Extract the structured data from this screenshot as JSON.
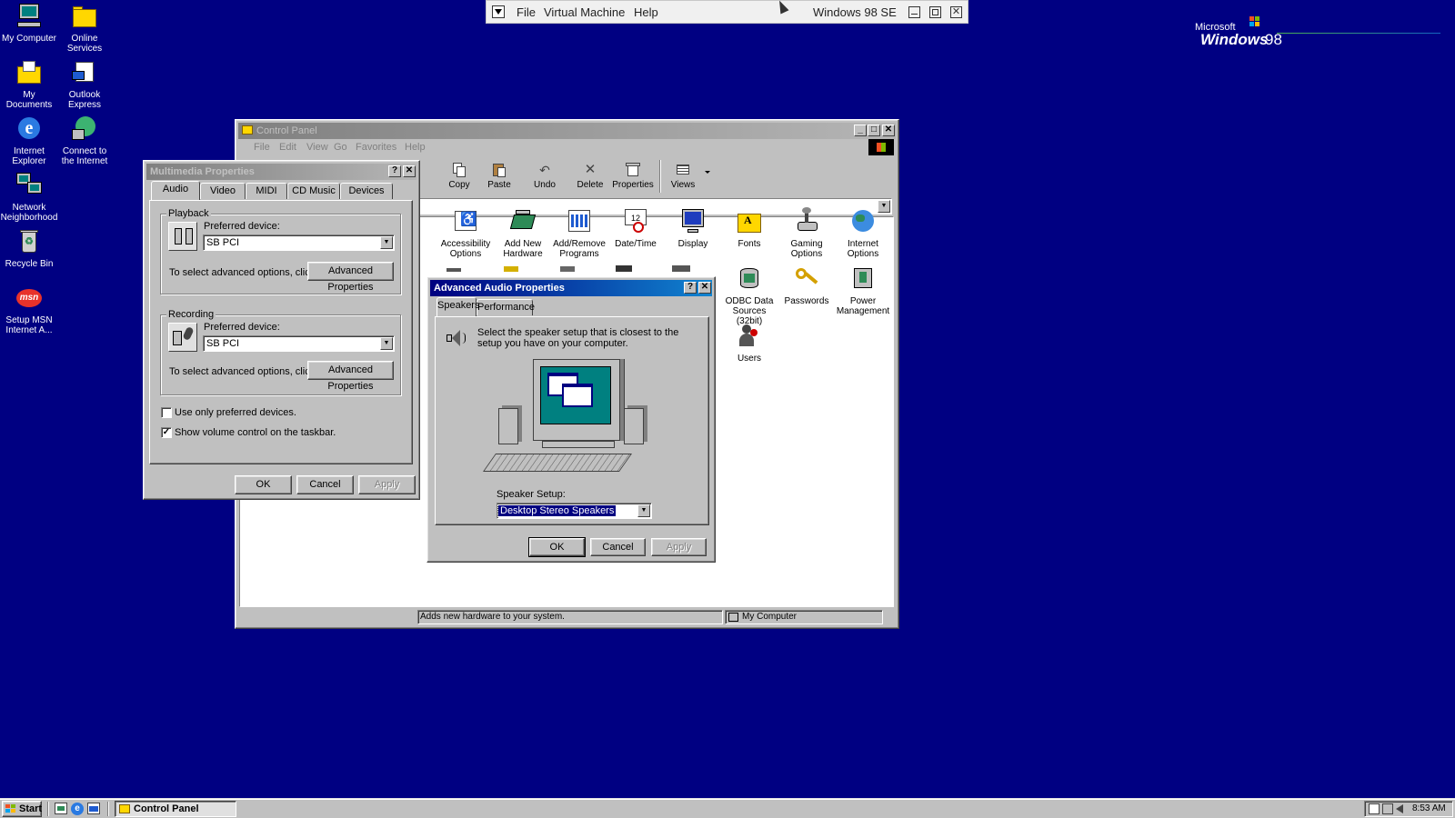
{
  "vm_bar": {
    "menu": [
      "File",
      "Virtual Machine",
      "Help"
    ],
    "os_title": "Windows 98 SE"
  },
  "logo": {
    "line1": "Microsoft",
    "line2": "Windows",
    "version": "98"
  },
  "desktop_icons": [
    {
      "label": "My Computer",
      "icon": "my-computer-icon"
    },
    {
      "label": "Online Services",
      "icon": "folder-icon"
    },
    {
      "label": "My Documents",
      "icon": "my-documents-icon"
    },
    {
      "label": "Outlook Express",
      "icon": "outlook-express-icon"
    },
    {
      "label": "Internet Explorer",
      "icon": "internet-explorer-icon"
    },
    {
      "label": "Connect to the Internet",
      "icon": "connect-internet-icon"
    },
    {
      "label": "Network Neighborhood",
      "icon": "network-icon"
    },
    {
      "label": "Recycle Bin",
      "icon": "recycle-bin-icon"
    },
    {
      "label": "Setup MSN Internet A...",
      "icon": "msn-icon"
    }
  ],
  "control_panel": {
    "title": "Control Panel",
    "menu": [
      "File",
      "Edit",
      "View",
      "Go",
      "Favorites",
      "Help"
    ],
    "toolbar": [
      "Copy",
      "Paste",
      "Undo",
      "Delete",
      "Properties",
      "Views"
    ],
    "items_row1": [
      "Accessibility Options",
      "Add New Hardware",
      "Add/Remove Programs",
      "Date/Time",
      "Display",
      "Fonts",
      "Gaming Options",
      "Internet Options"
    ],
    "items_row2": [
      "ODBC Data Sources (32bit)",
      "Passwords",
      "Power Management"
    ],
    "items_row3": [
      "Users"
    ],
    "status_left": "Adds new hardware to your system.",
    "status_right": "My Computer"
  },
  "multimedia": {
    "title": "Multimedia Properties",
    "tabs": [
      "Audio",
      "Video",
      "MIDI",
      "CD Music",
      "Devices"
    ],
    "playback": {
      "label": "Playback",
      "device_label": "Preferred device:",
      "device_value": "SB PCI",
      "advanced_text": "To select advanced options, click:",
      "advanced_button": "Advanced Properties"
    },
    "recording": {
      "label": "Recording",
      "device_label": "Preferred device:",
      "device_value": "SB PCI",
      "advanced_text": "To select advanced options, click:",
      "advanced_button": "Advanced Properties"
    },
    "use_only_preferred": "Use only preferred devices.",
    "show_volume": "Show volume control on the taskbar.",
    "ok": "OK",
    "cancel": "Cancel",
    "apply": "Apply"
  },
  "advanced_audio": {
    "title": "Advanced Audio Properties",
    "tabs": [
      "Speakers",
      "Performance"
    ],
    "description": "Select the speaker setup that is closest to the setup you have on your computer.",
    "speaker_setup_label": "Speaker Setup:",
    "speaker_setup_value": "Desktop Stereo Speakers",
    "ok": "OK",
    "cancel": "Cancel",
    "apply": "Apply"
  },
  "taskbar": {
    "start": "Start",
    "task": "Control Panel",
    "clock": "8:53 AM"
  }
}
